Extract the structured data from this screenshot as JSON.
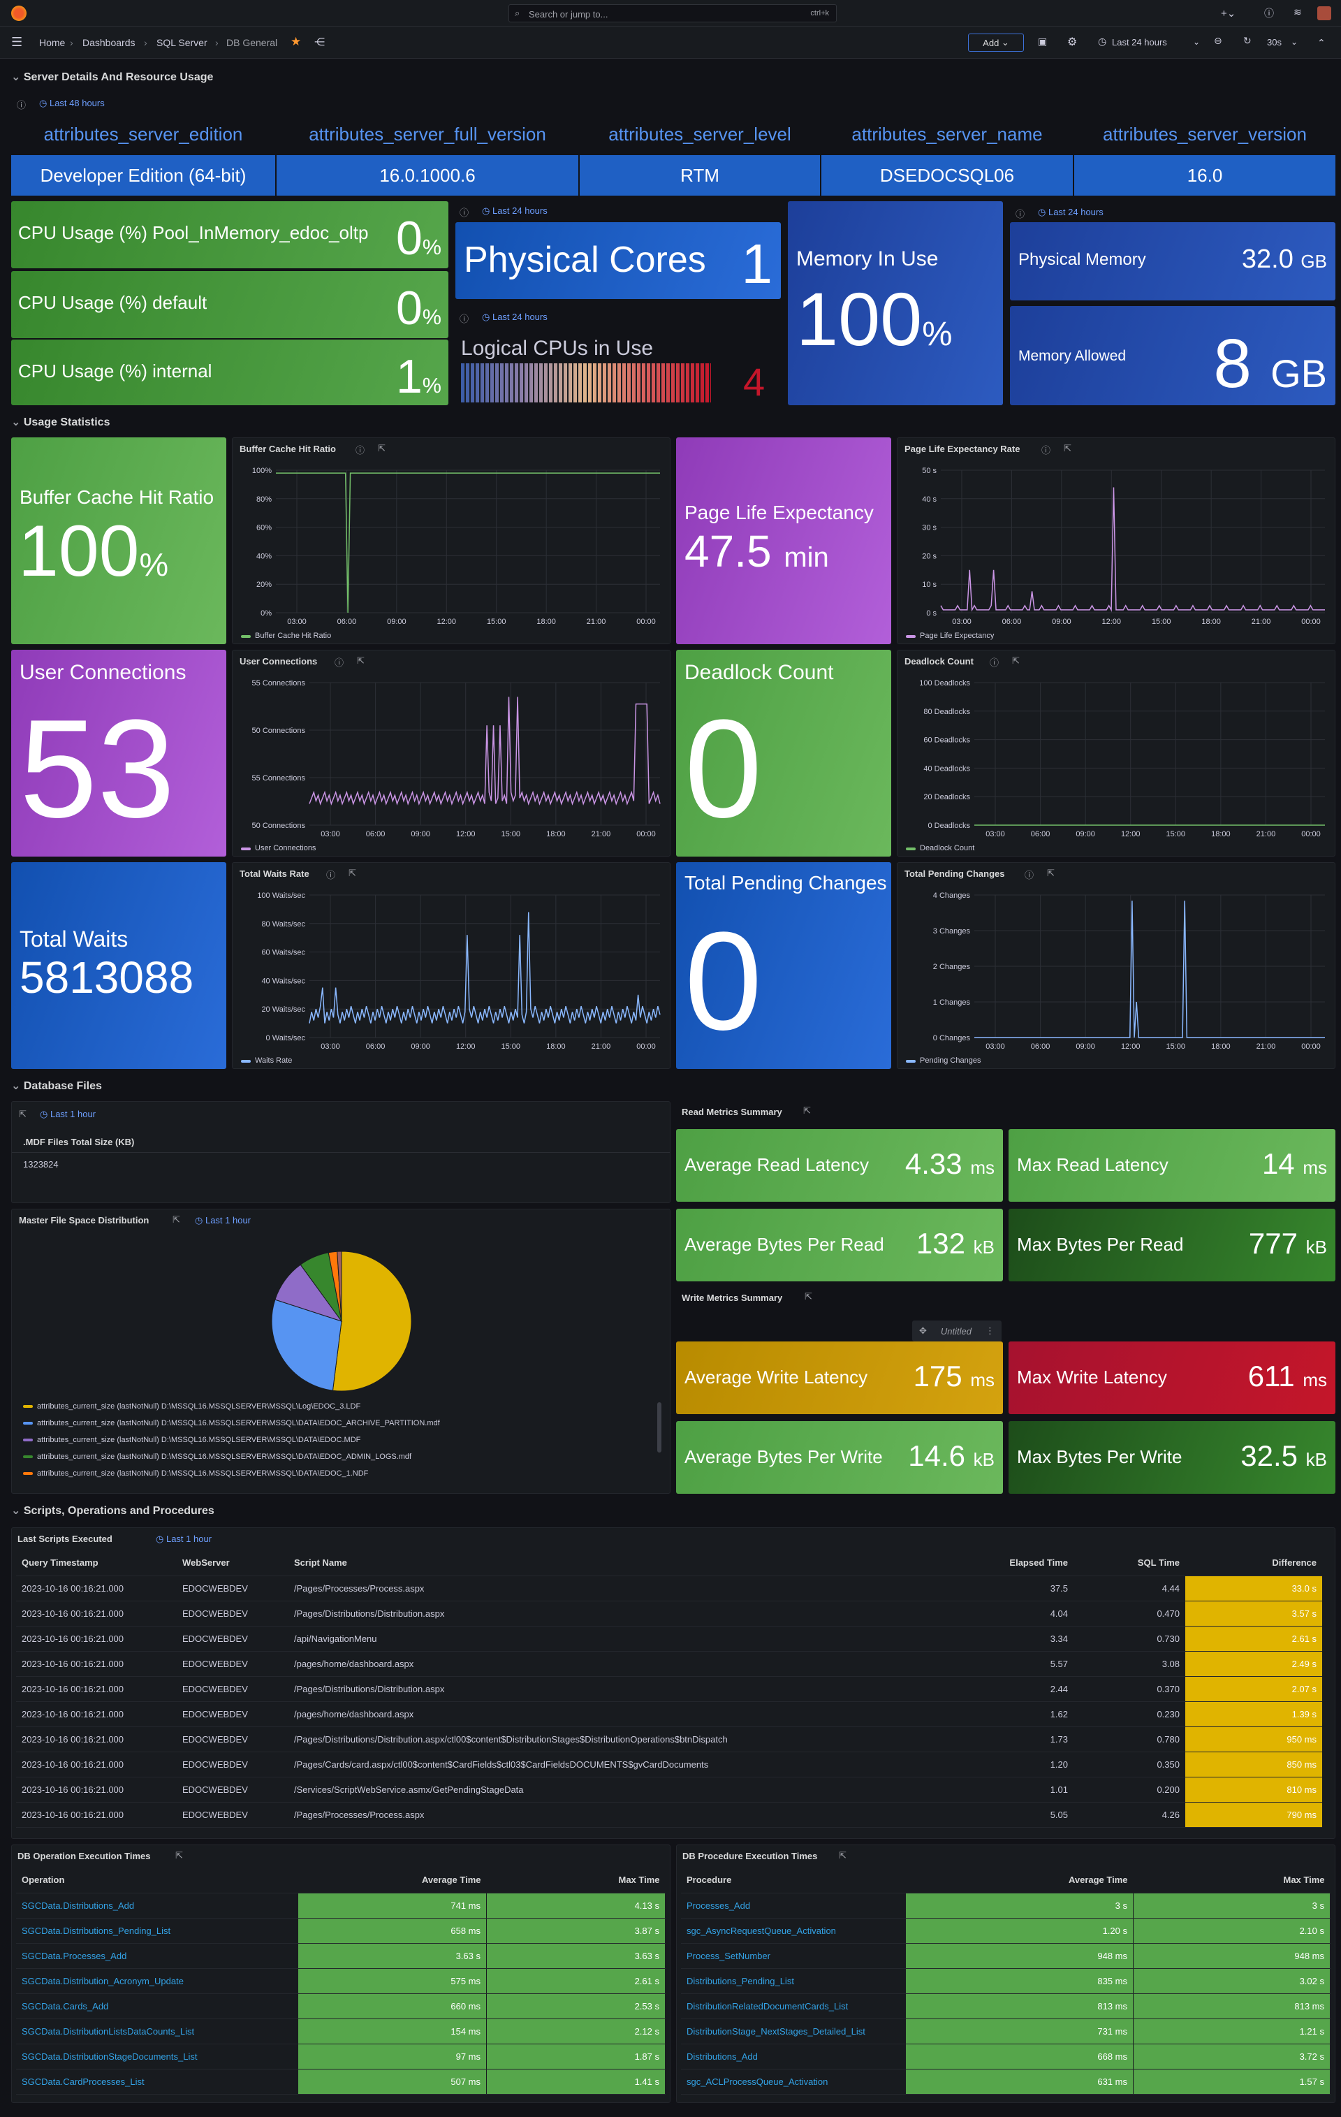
{
  "topbar": {
    "search_placeholder": "Search or jump to...",
    "shortcut": "ctrl+k"
  },
  "nav": {
    "breadcrumbs": [
      "Home",
      "Dashboards",
      "SQL Server",
      "DB General"
    ],
    "add": "Add",
    "time": "Last 24 hours",
    "refresh": "30s"
  },
  "rows": [
    "Server Details And Resource Usage",
    "Usage Statistics",
    "Database Files",
    "Scripts, Operations and Procedures"
  ],
  "server": {
    "time": "Last 48 hours",
    "headers": [
      "attributes_server_edition",
      "attributes_server_full_version",
      "attributes_server_level",
      "attributes_server_name",
      "attributes_server_version"
    ],
    "values": [
      "Developer Edition (64-bit)",
      "16.0.1000.6",
      "RTM",
      "DSEDOCSQL06",
      "16.0"
    ]
  },
  "cpu": [
    {
      "label": "CPU Usage (%) Pool_InMemory_edoc_oltp",
      "value": "0",
      "unit": "%"
    },
    {
      "label": "CPU Usage (%) default",
      "value": "0",
      "unit": "%"
    },
    {
      "label": "CPU Usage (%) internal",
      "value": "1",
      "unit": "%"
    }
  ],
  "cores": {
    "time": "Last 24 hours",
    "label": "Physical Cores",
    "value": "1"
  },
  "logical": {
    "time": "Last 24 hours",
    "label": "Logical CPUs in Use",
    "value": "4"
  },
  "memuse": {
    "label": "Memory In Use",
    "value": "100",
    "unit": "%"
  },
  "physmem": {
    "time": "Last 24 hours",
    "label": "Physical Memory",
    "value": "32.0",
    "unit": "GB"
  },
  "memallow": {
    "label": "Memory Allowed",
    "value": "8",
    "unit": "GB"
  },
  "usage": {
    "bch": {
      "label": "Buffer Cache Hit Ratio",
      "value": "100",
      "unit": "%"
    },
    "ple": {
      "label": "Page Life Expectancy",
      "value": "47.5",
      "unit": "min"
    },
    "uc": {
      "label": "User Connections",
      "value": "53"
    },
    "dl": {
      "label": "Deadlock Count",
      "value": "0"
    },
    "tw": {
      "label": "Total Waits",
      "value": "5813088"
    },
    "tpc": {
      "label": "Total Pending Changes",
      "value": "0"
    }
  },
  "chart_data": [
    {
      "type": "line",
      "title": "Buffer Cache Hit Ratio",
      "legend": "Buffer Cache Hit Ratio",
      "x": [
        "03:00",
        "06:00",
        "09:00",
        "12:00",
        "15:00",
        "18:00",
        "21:00",
        "00:00"
      ],
      "yticks": [
        "0%",
        "20%",
        "40%",
        "60%",
        "80%",
        "100%"
      ],
      "ylim": [
        0,
        100
      ],
      "color": "#73bf69"
    },
    {
      "type": "line",
      "title": "Page Life Expectancy Rate",
      "legend": "Page Life Expectancy",
      "x": [
        "03:00",
        "06:00",
        "09:00",
        "12:00",
        "15:00",
        "18:00",
        "21:00",
        "00:00"
      ],
      "yticks": [
        "0 s",
        "10 s",
        "20 s",
        "30 s",
        "40 s",
        "50 s"
      ],
      "ylim": [
        0,
        50
      ],
      "color": "#ca95e5"
    },
    {
      "type": "line",
      "title": "User Connections",
      "legend": "User Connections",
      "x": [
        "03:00",
        "06:00",
        "09:00",
        "12:00",
        "15:00",
        "18:00",
        "21:00",
        "00:00"
      ],
      "yticks": [
        "50 Connections",
        "55 Connections",
        "50 Connections",
        "55 Connections"
      ],
      "color": "#ca95e5"
    },
    {
      "type": "line",
      "title": "Deadlock Count",
      "legend": "Deadlock Count",
      "x": [
        "03:00",
        "06:00",
        "09:00",
        "12:00",
        "15:00",
        "18:00",
        "21:00",
        "00:00"
      ],
      "yticks": [
        "0 Deadlocks",
        "20 Deadlocks",
        "40 Deadlocks",
        "60 Deadlocks",
        "80 Deadlocks",
        "100 Deadlocks"
      ],
      "ylim": [
        0,
        100
      ],
      "color": "#73bf69"
    },
    {
      "type": "line",
      "title": "Total Waits Rate",
      "legend": "Waits Rate",
      "x": [
        "03:00",
        "06:00",
        "09:00",
        "12:00",
        "15:00",
        "18:00",
        "21:00",
        "00:00"
      ],
      "yticks": [
        "0 Waits/sec",
        "20 Waits/sec",
        "40 Waits/sec",
        "60 Waits/sec",
        "80 Waits/sec",
        "100 Waits/sec"
      ],
      "ylim": [
        0,
        100
      ],
      "color": "#8ab8ff"
    },
    {
      "type": "line",
      "title": "Total Pending Changes",
      "legend": "Pending Changes",
      "x": [
        "03:00",
        "06:00",
        "09:00",
        "12:00",
        "15:00",
        "18:00",
        "21:00",
        "00:00"
      ],
      "yticks": [
        "0 Changes",
        "1 Changes",
        "2 Changes",
        "3 Changes",
        "4 Changes"
      ],
      "ylim": [
        0,
        4
      ],
      "color": "#8ab8ff"
    },
    {
      "type": "pie",
      "title": "Master File Space Distribution",
      "values": [
        52,
        28,
        10,
        7,
        2,
        1
      ],
      "colors": [
        "#e0b400",
        "#5794f2",
        "#8f6cc8",
        "#37872d",
        "#ff780a",
        "#a16060"
      ],
      "legend": [
        "attributes_current_size (lastNotNull) D:\\MSSQL16.MSSQLSERVER\\MSSQL\\Log\\EDOC_3.LDF",
        "attributes_current_size (lastNotNull) D:\\MSSQL16.MSSQLSERVER\\MSSQL\\DATA\\EDOC_ARCHIVE_PARTITION.mdf",
        "attributes_current_size (lastNotNull) D:\\MSSQL16.MSSQLSERVER\\MSSQL\\DATA\\EDOC.MDF",
        "attributes_current_size (lastNotNull) D:\\MSSQL16.MSSQLSERVER\\MSSQL\\DATA\\EDOC_ADMIN_LOGS.mdf",
        "attributes_current_size (lastNotNull) D:\\MSSQL16.MSSQLSERVER\\MSSQL\\DATA\\EDOC_1.NDF"
      ],
      "legend_colors": [
        "#e0b400",
        "#5794f2",
        "#8f6cc8",
        "#37872d",
        "#ff780a"
      ]
    }
  ],
  "mdf": {
    "time": "Last 1 hour",
    "label": ".MDF Files Total Size (KB)",
    "value": "1323824"
  },
  "pie": {
    "time": "Last 1 hour"
  },
  "read": {
    "title": "Read Metrics Summary",
    "items": [
      {
        "label": "Average Read Latency",
        "value": "4.33",
        "unit": "ms"
      },
      {
        "label": "Max Read Latency",
        "value": "14",
        "unit": "ms"
      },
      {
        "label": "Average Bytes Per Read",
        "value": "132",
        "unit": "kB"
      },
      {
        "label": "Max Bytes Per Read",
        "value": "777",
        "unit": "kB"
      }
    ]
  },
  "write": {
    "title": "Write Metrics Summary",
    "untitled": "Untitled",
    "items": [
      {
        "label": "Average Write Latency",
        "value": "175",
        "unit": "ms"
      },
      {
        "label": "Max Write Latency",
        "value": "611",
        "unit": "ms"
      },
      {
        "label": "Average Bytes Per Write",
        "value": "14.6",
        "unit": "kB"
      },
      {
        "label": "Max Bytes Per Write",
        "value": "32.5",
        "unit": "kB"
      }
    ]
  },
  "scripts": {
    "title": "Last Scripts Executed",
    "time": "Last 1 hour",
    "headers": [
      "Query Timestamp",
      "WebServer",
      "Script Name",
      "Elapsed Time",
      "SQL Time",
      "Difference"
    ],
    "rows": [
      [
        "2023-10-16 00:16:21.000",
        "EDOCWEBDEV",
        "/Pages/Processes/Process.aspx",
        "37.5",
        "4.44",
        "33.0 s"
      ],
      [
        "2023-10-16 00:16:21.000",
        "EDOCWEBDEV",
        "/Pages/Distributions/Distribution.aspx",
        "4.04",
        "0.470",
        "3.57 s"
      ],
      [
        "2023-10-16 00:16:21.000",
        "EDOCWEBDEV",
        "/api/NavigationMenu",
        "3.34",
        "0.730",
        "2.61 s"
      ],
      [
        "2023-10-16 00:16:21.000",
        "EDOCWEBDEV",
        "/pages/home/dashboard.aspx",
        "5.57",
        "3.08",
        "2.49 s"
      ],
      [
        "2023-10-16 00:16:21.000",
        "EDOCWEBDEV",
        "/Pages/Distributions/Distribution.aspx",
        "2.44",
        "0.370",
        "2.07 s"
      ],
      [
        "2023-10-16 00:16:21.000",
        "EDOCWEBDEV",
        "/pages/home/dashboard.aspx",
        "1.62",
        "0.230",
        "1.39 s"
      ],
      [
        "2023-10-16 00:16:21.000",
        "EDOCWEBDEV",
        "/Pages/Distributions/Distribution.aspx/ctl00$content$DistributionStages$DistributionOperations$btnDispatch",
        "1.73",
        "0.780",
        "950 ms"
      ],
      [
        "2023-10-16 00:16:21.000",
        "EDOCWEBDEV",
        "/Pages/Cards/card.aspx/ctl00$content$CardFields$ctl03$CardFieldsDOCUMENTS$gvCardDocuments",
        "1.20",
        "0.350",
        "850 ms"
      ],
      [
        "2023-10-16 00:16:21.000",
        "EDOCWEBDEV",
        "/Services/ScriptWebService.asmx/GetPendingStageData",
        "1.01",
        "0.200",
        "810 ms"
      ],
      [
        "2023-10-16 00:16:21.000",
        "EDOCWEBDEV",
        "/Pages/Processes/Process.aspx",
        "5.05",
        "4.26",
        "790 ms"
      ]
    ]
  },
  "ops": {
    "title": "DB Operation Execution Times",
    "headers": [
      "Operation",
      "Average Time",
      "Max Time"
    ],
    "rows": [
      [
        "SGCData.Distributions_Add",
        "741 ms",
        "4.13 s"
      ],
      [
        "SGCData.Distributions_Pending_List",
        "658 ms",
        "3.87 s"
      ],
      [
        "SGCData.Processes_Add",
        "3.63 s",
        "3.63 s"
      ],
      [
        "SGCData.Distribution_Acronym_Update",
        "575 ms",
        "2.61 s"
      ],
      [
        "SGCData.Cards_Add",
        "660 ms",
        "2.53 s"
      ],
      [
        "SGCData.DistributionListsDataCounts_List",
        "154 ms",
        "2.12 s"
      ],
      [
        "SGCData.DistributionStageDocuments_List",
        "97 ms",
        "1.87 s"
      ],
      [
        "SGCData.CardProcesses_List",
        "507 ms",
        "1.41 s"
      ]
    ]
  },
  "procs": {
    "title": "DB Procedure Execution Times",
    "headers": [
      "Procedure",
      "Average Time",
      "Max Time"
    ],
    "rows": [
      [
        "Processes_Add",
        "3 s",
        "3 s"
      ],
      [
        "sgc_AsyncRequestQueue_Activation",
        "1.20 s",
        "2.10 s"
      ],
      [
        "Process_SetNumber",
        "948 ms",
        "948 ms"
      ],
      [
        "Distributions_Pending_List",
        "835 ms",
        "3.02 s"
      ],
      [
        "DistributionRelatedDocumentCards_List",
        "813 ms",
        "813 ms"
      ],
      [
        "DistributionStage_NextStages_Detailed_List",
        "731 ms",
        "1.21 s"
      ],
      [
        "Distributions_Add",
        "668 ms",
        "3.72 s"
      ],
      [
        "sgc_ACLProcessQueue_Activation",
        "631 ms",
        "1.57 s"
      ]
    ]
  }
}
